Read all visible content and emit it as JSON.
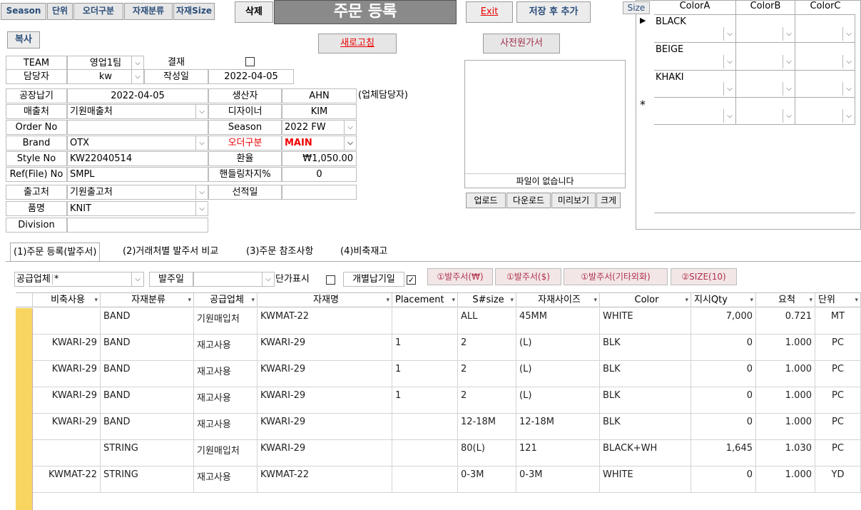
{
  "top_buttons": [
    "Season",
    "단위",
    "오더구분",
    "자재분류",
    "자재Size"
  ],
  "delete_label": "삭제",
  "title": "주문 등록",
  "exit_label": "Exit",
  "save_add_label": "저장 후 추가",
  "copy_label": "복사",
  "refresh_label": "새로고침",
  "preview_title": "사전원가서",
  "no_file": "파일이 없습니다",
  "file_buttons": [
    "업로드",
    "다운로드",
    "미리보기",
    "크게"
  ],
  "team": {
    "label": "TEAM",
    "value": "영업1팀",
    "approval_label": "결재"
  },
  "manager": {
    "label": "담당자",
    "value": "kw",
    "date_label": "작성일",
    "date_value": "2022-04-05"
  },
  "form_left": [
    {
      "label": "공장납기",
      "value": "2022-04-05"
    },
    {
      "label": "매출처",
      "value": "기원매출처"
    },
    {
      "label": "Order No",
      "value": ""
    },
    {
      "label": "Brand",
      "value": "OTX"
    },
    {
      "label": "Style No",
      "value": "KW22040514"
    },
    {
      "label": "Ref(File) No",
      "value": "SMPL"
    },
    {
      "label": "출고처",
      "value": "기원출고처"
    },
    {
      "label": "품명",
      "value": "KNIT"
    },
    {
      "label": "Division",
      "value": ""
    }
  ],
  "form_right": [
    {
      "label": "생산자",
      "value": "AHN"
    },
    {
      "label": "디자이너",
      "value": "KIM"
    },
    {
      "label": "Season",
      "value": "2022 FW"
    },
    {
      "label": "오더구분",
      "value": "MAIN"
    },
    {
      "label": "환율",
      "value": "₩1,050.00"
    },
    {
      "label": "핸들링차지%",
      "value": "0"
    },
    {
      "label": "선적일",
      "value": ""
    }
  ],
  "vendor_note": "(업체담당자)",
  "color_grid": {
    "headers": [
      "Size",
      "ColorA",
      "ColorB",
      "ColorC"
    ],
    "rows": [
      "BLACK",
      "BEIGE",
      "KHAKI",
      ""
    ]
  },
  "tabs": [
    "(1)주문 등록(발주서)",
    "(2)거래처별 발주서 비교",
    "(3)주문 참조사항",
    "(4)비축재고"
  ],
  "filter": {
    "supplier_label": "공급업체",
    "supplier_value": "*",
    "order_date_label": "발주일",
    "order_date_value": "",
    "unit_price_label": "단가표시",
    "individual_label": "개별납기일"
  },
  "order_buttons": [
    "①발주서(₩)",
    "①발주서($)",
    "①발주서(기타외화)",
    "②SIZE(10)"
  ],
  "grid": {
    "headers": [
      "비축사용",
      "자재분류",
      "공급업체",
      "자재명",
      "Placement",
      "S#size",
      "자재사이즈",
      "Color",
      "지시Qty",
      "요척",
      "단위"
    ],
    "rows": [
      [
        "",
        "BAND",
        "기원매입처",
        "KWMAT-22",
        "",
        "ALL",
        "45MM",
        "WHITE",
        "7,000",
        "0.721",
        "MT"
      ],
      [
        "KWARI-29",
        "BAND",
        "재고사용",
        "KWARI-29",
        "1",
        "2",
        "(L)",
        "BLK",
        "0",
        "1.000",
        "PC"
      ],
      [
        "KWARI-29",
        "BAND",
        "재고사용",
        "KWARI-29",
        "1",
        "2",
        "(L)",
        "BLK",
        "0",
        "1.000",
        "PC"
      ],
      [
        "KWARI-29",
        "BAND",
        "재고사용",
        "KWARI-29",
        "1",
        "2",
        "(L)",
        "BLK",
        "0",
        "1.000",
        "PC"
      ],
      [
        "KWARI-29",
        "BAND",
        "재고사용",
        "KWARI-29",
        "",
        "12-18M",
        "12-18M",
        "BLK",
        "0",
        "1.000",
        "PC"
      ],
      [
        "",
        "STRING",
        "기원매입처",
        "KWARI-29",
        "",
        "80(L)",
        "121",
        "BLACK+WH",
        "1,645",
        "1.030",
        "PC"
      ],
      [
        "KWMAT-22",
        "STRING",
        "재고사용",
        "KWMAT-22",
        "",
        "0-3M",
        "0-3M",
        "WHITE",
        "0",
        "1.000",
        "YD"
      ]
    ]
  },
  "colors": {
    "accent_red": "#e00000",
    "title_bg": "#8a8a8a",
    "row_selector": "#f7d560"
  }
}
